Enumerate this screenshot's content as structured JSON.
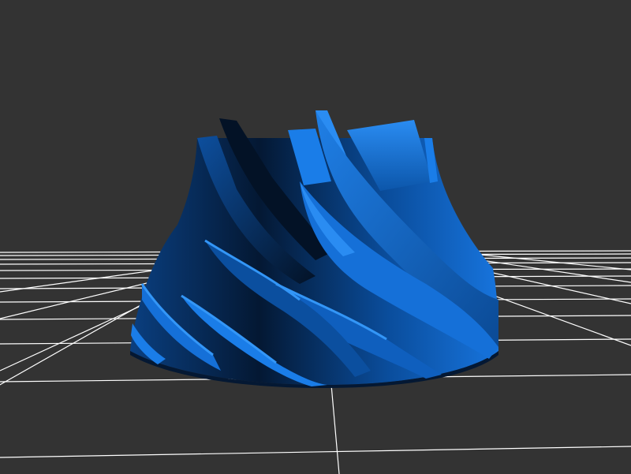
{
  "viewer": {
    "background": "#333333",
    "grid_color": "#ffffff",
    "model_color": "#0f6fd6",
    "model_shade_dark": "#061a33",
    "model_shade_light": "#2b8cf0",
    "camera_view": "perspective",
    "grid_visible": true
  },
  "model": {
    "shape": "impeller",
    "blade_count_visible": 10
  }
}
